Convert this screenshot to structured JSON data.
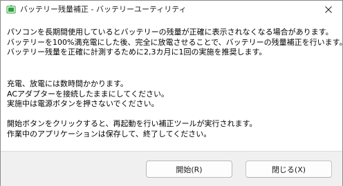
{
  "window": {
    "title": "バッテリー残量補正 - バッテリーユーティリティ"
  },
  "message": {
    "para1": [
      "パソコンを長期間使用しているとバッテリーの残量が正確に表示されなくなる場合があります。",
      "バッテリーを100%満充電にした後、完全に放電させることで、バッテリーの残量補正を行います。",
      "バッテリー残量を正確に計測するために2,3カ月に1回の実施を推奨します。"
    ],
    "para2": [
      "充電、放電には数時間かかります。",
      "ACアダプターを接続したままにしてください。",
      "実施中は電源ボタンを押さないでください。"
    ],
    "para3": [
      "開始ボタンをクリックすると、再起動を行い補正ツールが実行されます。",
      "作業中のアプリケーションは保存して、終了してください。"
    ]
  },
  "buttons": {
    "start_label": "開始(R)",
    "close_label": "閉じる(X)"
  },
  "icons": {
    "app": "battery-app-icon",
    "close": "close-icon"
  },
  "colors": {
    "footer_bg": "#f0f0f0",
    "icon_green": "#2e9e3e"
  }
}
